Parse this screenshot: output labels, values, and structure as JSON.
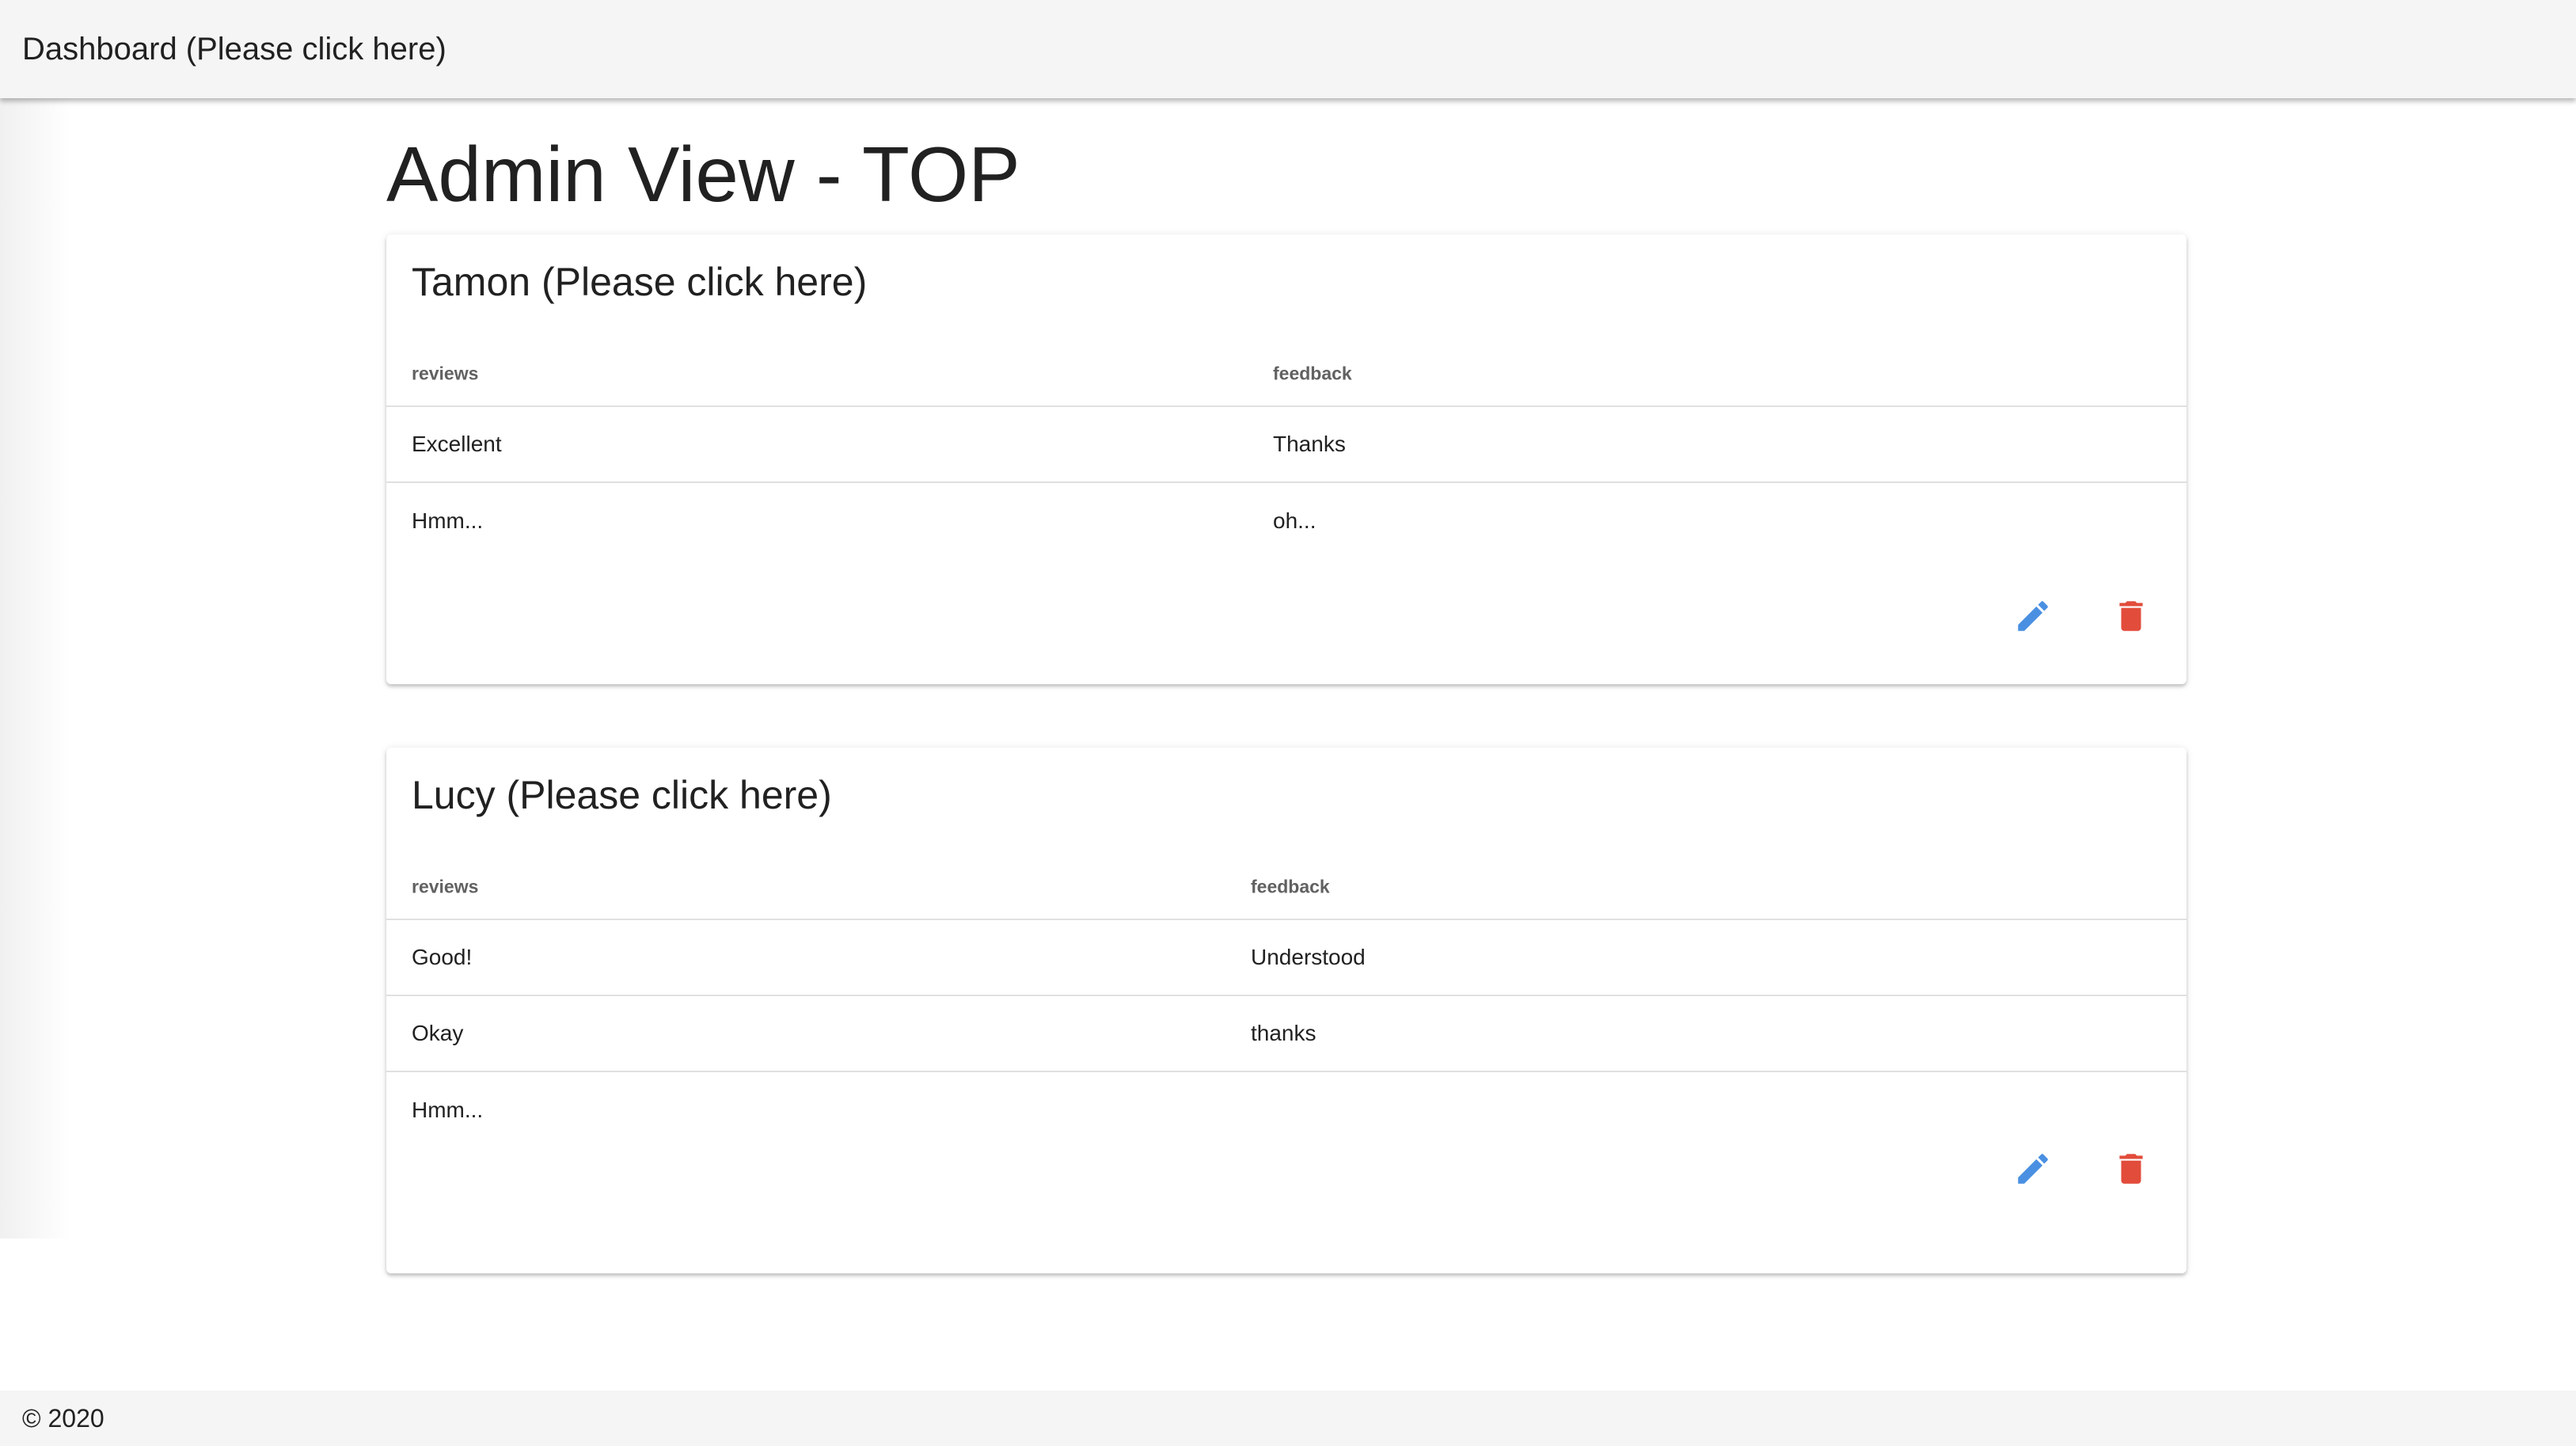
{
  "app_bar": {
    "title": "Dashboard (Please click here)"
  },
  "page": {
    "title": "Admin View - TOP"
  },
  "colors": {
    "edit": "#4a90e2",
    "delete": "#e24c3b",
    "bar": "#f5f5f5"
  },
  "cards": [
    {
      "name": "Tamon (Please click here)",
      "headers": {
        "reviews": "reviews",
        "feedback": "feedback"
      },
      "rows": [
        {
          "review": "Excellent",
          "feedback": "Thanks"
        },
        {
          "review": "Hmm...",
          "feedback": "oh..."
        }
      ],
      "actions": {
        "edit_icon": "pencil-icon",
        "delete_icon": "trash-icon"
      }
    },
    {
      "name": "Lucy (Please click here)",
      "headers": {
        "reviews": "reviews",
        "feedback": "feedback"
      },
      "rows": [
        {
          "review": "Good!",
          "feedback": "Understood"
        },
        {
          "review": "Okay",
          "feedback": "thanks"
        },
        {
          "review": "Hmm...",
          "feedback": ""
        }
      ],
      "actions": {
        "edit_icon": "pencil-icon",
        "delete_icon": "trash-icon"
      }
    }
  ],
  "footer": {
    "text": "© 2020"
  }
}
